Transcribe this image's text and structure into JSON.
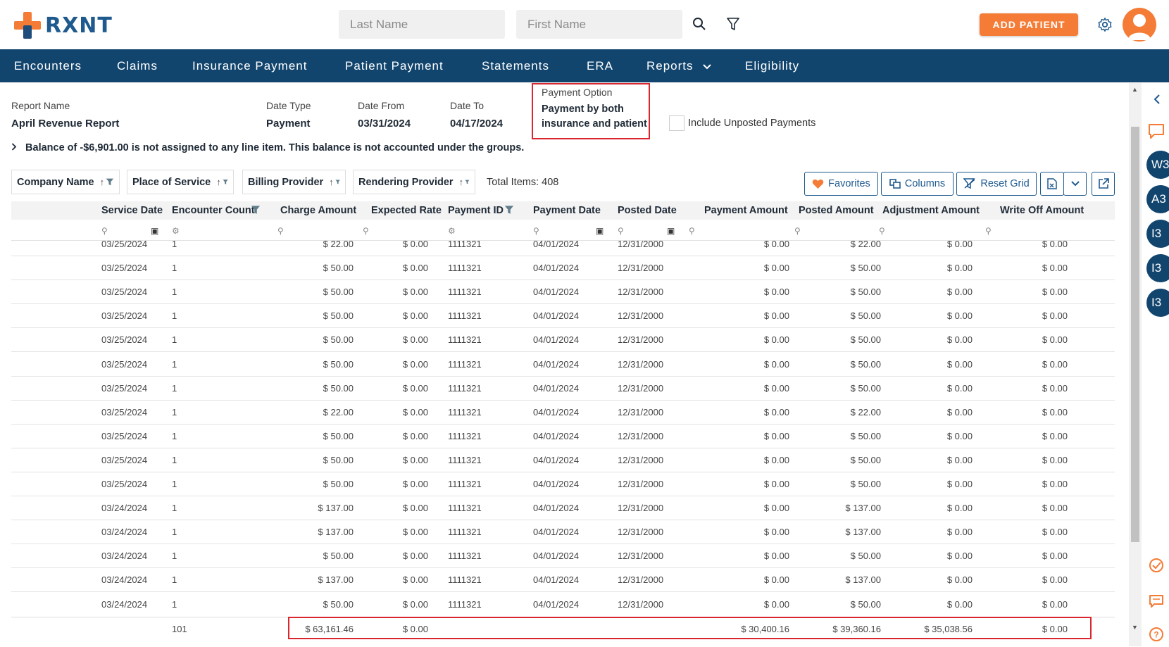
{
  "header": {
    "logo_text": "RXNT",
    "last_name_placeholder": "Last Name",
    "first_name_placeholder": "First Name",
    "add_patient_label": "ADD PATIENT"
  },
  "nav": {
    "items": [
      "Encounters",
      "Claims",
      "Insurance Payment",
      "Patient Payment",
      "Statements",
      "ERA",
      "Reports",
      "Eligibility"
    ]
  },
  "report": {
    "report_name_label": "Report Name",
    "report_name": "April Revenue Report",
    "date_type_label": "Date Type",
    "date_type": "Payment",
    "date_from_label": "Date From",
    "date_from": "03/31/2024",
    "date_to_label": "Date To",
    "date_to": "04/17/2024",
    "payment_option_label": "Payment Option",
    "payment_option_line1": "Payment by both",
    "payment_option_line2": "insurance and patient",
    "include_unposted_label": "Include Unposted Payments",
    "balance_note": "Balance of -$6,901.00 is not assigned to any line item. This balance is not accounted under the groups."
  },
  "groups": {
    "chips": [
      "Company Name",
      "Place of Service",
      "Billing Provider",
      "Rendering Provider"
    ],
    "total_items": "Total Items: 408"
  },
  "toolbar": {
    "favorites": "Favorites",
    "columns": "Columns",
    "reset_grid": "Reset Grid"
  },
  "grid": {
    "columns": [
      "Service Date",
      "Encounter Count",
      "Charge Amount",
      "Expected Rate",
      "Payment ID",
      "Payment Date",
      "Posted Date",
      "Payment Amount",
      "Posted Amount",
      "Adjustment Amount",
      "Write Off Amount"
    ],
    "rows": [
      [
        "03/25/2024",
        "1",
        "$ 22.00",
        "$ 0.00",
        "1111321",
        "04/01/2024",
        "12/31/2000",
        "$ 0.00",
        "$ 22.00",
        "$ 0.00",
        "$ 0.00"
      ],
      [
        "03/25/2024",
        "1",
        "$ 50.00",
        "$ 0.00",
        "1111321",
        "04/01/2024",
        "12/31/2000",
        "$ 0.00",
        "$ 50.00",
        "$ 0.00",
        "$ 0.00"
      ],
      [
        "03/25/2024",
        "1",
        "$ 50.00",
        "$ 0.00",
        "1111321",
        "04/01/2024",
        "12/31/2000",
        "$ 0.00",
        "$ 50.00",
        "$ 0.00",
        "$ 0.00"
      ],
      [
        "03/25/2024",
        "1",
        "$ 50.00",
        "$ 0.00",
        "1111321",
        "04/01/2024",
        "12/31/2000",
        "$ 0.00",
        "$ 50.00",
        "$ 0.00",
        "$ 0.00"
      ],
      [
        "03/25/2024",
        "1",
        "$ 50.00",
        "$ 0.00",
        "1111321",
        "04/01/2024",
        "12/31/2000",
        "$ 0.00",
        "$ 50.00",
        "$ 0.00",
        "$ 0.00"
      ],
      [
        "03/25/2024",
        "1",
        "$ 50.00",
        "$ 0.00",
        "1111321",
        "04/01/2024",
        "12/31/2000",
        "$ 0.00",
        "$ 50.00",
        "$ 0.00",
        "$ 0.00"
      ],
      [
        "03/25/2024",
        "1",
        "$ 50.00",
        "$ 0.00",
        "1111321",
        "04/01/2024",
        "12/31/2000",
        "$ 0.00",
        "$ 50.00",
        "$ 0.00",
        "$ 0.00"
      ],
      [
        "03/25/2024",
        "1",
        "$ 22.00",
        "$ 0.00",
        "1111321",
        "04/01/2024",
        "12/31/2000",
        "$ 0.00",
        "$ 22.00",
        "$ 0.00",
        "$ 0.00"
      ],
      [
        "03/25/2024",
        "1",
        "$ 50.00",
        "$ 0.00",
        "1111321",
        "04/01/2024",
        "12/31/2000",
        "$ 0.00",
        "$ 50.00",
        "$ 0.00",
        "$ 0.00"
      ],
      [
        "03/25/2024",
        "1",
        "$ 50.00",
        "$ 0.00",
        "1111321",
        "04/01/2024",
        "12/31/2000",
        "$ 0.00",
        "$ 50.00",
        "$ 0.00",
        "$ 0.00"
      ],
      [
        "03/25/2024",
        "1",
        "$ 50.00",
        "$ 0.00",
        "1111321",
        "04/01/2024",
        "12/31/2000",
        "$ 0.00",
        "$ 50.00",
        "$ 0.00",
        "$ 0.00"
      ],
      [
        "03/24/2024",
        "1",
        "$ 137.00",
        "$ 0.00",
        "1111321",
        "04/01/2024",
        "12/31/2000",
        "$ 0.00",
        "$ 137.00",
        "$ 0.00",
        "$ 0.00"
      ],
      [
        "03/24/2024",
        "1",
        "$ 137.00",
        "$ 0.00",
        "1111321",
        "04/01/2024",
        "12/31/2000",
        "$ 0.00",
        "$ 137.00",
        "$ 0.00",
        "$ 0.00"
      ],
      [
        "03/24/2024",
        "1",
        "$ 50.00",
        "$ 0.00",
        "1111321",
        "04/01/2024",
        "12/31/2000",
        "$ 0.00",
        "$ 50.00",
        "$ 0.00",
        "$ 0.00"
      ],
      [
        "03/24/2024",
        "1",
        "$ 137.00",
        "$ 0.00",
        "1111321",
        "04/01/2024",
        "12/31/2000",
        "$ 0.00",
        "$ 137.00",
        "$ 0.00",
        "$ 0.00"
      ],
      [
        "03/24/2024",
        "1",
        "$ 50.00",
        "$ 0.00",
        "1111321",
        "04/01/2024",
        "12/31/2000",
        "$ 0.00",
        "$ 50.00",
        "$ 0.00",
        "$ 0.00"
      ]
    ],
    "totals": {
      "encounter_count": "101",
      "charge_amount": "$ 63,161.46",
      "expected_rate": "$ 0.00",
      "payment_amount": "$ 30,400.16",
      "posted_amount": "$ 39,360.16",
      "adjustment_amount": "$ 35,038.56",
      "write_off_amount": "$ 0.00"
    }
  },
  "side_panel": {
    "bubbles": [
      "W3",
      "A3",
      "I3",
      "I3",
      "I3"
    ]
  },
  "colors": {
    "brand_navy": "#12456e",
    "brand_orange": "#f47c36",
    "highlight_red": "#d9262f"
  }
}
